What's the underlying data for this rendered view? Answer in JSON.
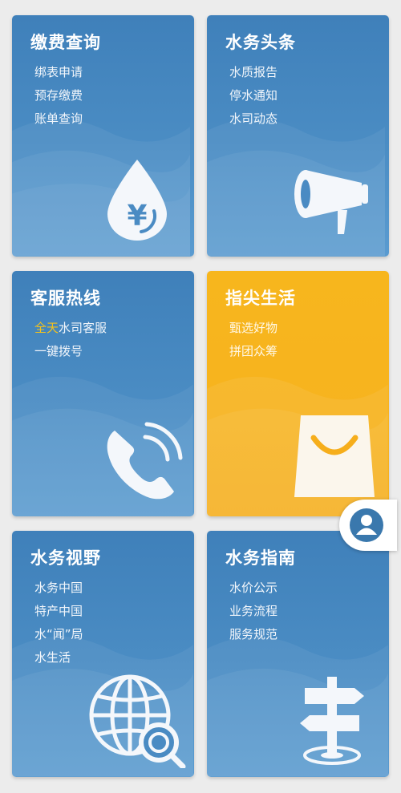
{
  "cards": [
    {
      "title": "缴费查询",
      "links": [
        "绑表申请",
        "预存缴费",
        "账单查询"
      ],
      "icon": "water-drop-yuan-icon"
    },
    {
      "title": "水务头条",
      "links": [
        "水质报告",
        "停水通知",
        "水司动态"
      ],
      "icon": "megaphone-icon"
    },
    {
      "title": "客服热线",
      "links_prefix": "全天",
      "links_rest": "水司客服",
      "links": [
        "一键拨号"
      ],
      "icon": "phone-icon"
    },
    {
      "title": "指尖生活",
      "links": [
        "甄选好物",
        "拼团众筹"
      ],
      "icon": "shopping-bag-icon"
    },
    {
      "title": "水务视野",
      "links": [
        "水务中国",
        "特产中国",
        "水“闻”局",
        "水生活"
      ],
      "icon": "globe-search-icon"
    },
    {
      "title": "水务指南",
      "links": [
        "水价公示",
        "业务流程",
        "服务规范"
      ],
      "icon": "signpost-icon"
    }
  ],
  "fab": {
    "icon": "user-icon"
  },
  "colors": {
    "blue": "#4286c0",
    "yellow": "#f7b31f",
    "highlight": "#f5c21b"
  }
}
